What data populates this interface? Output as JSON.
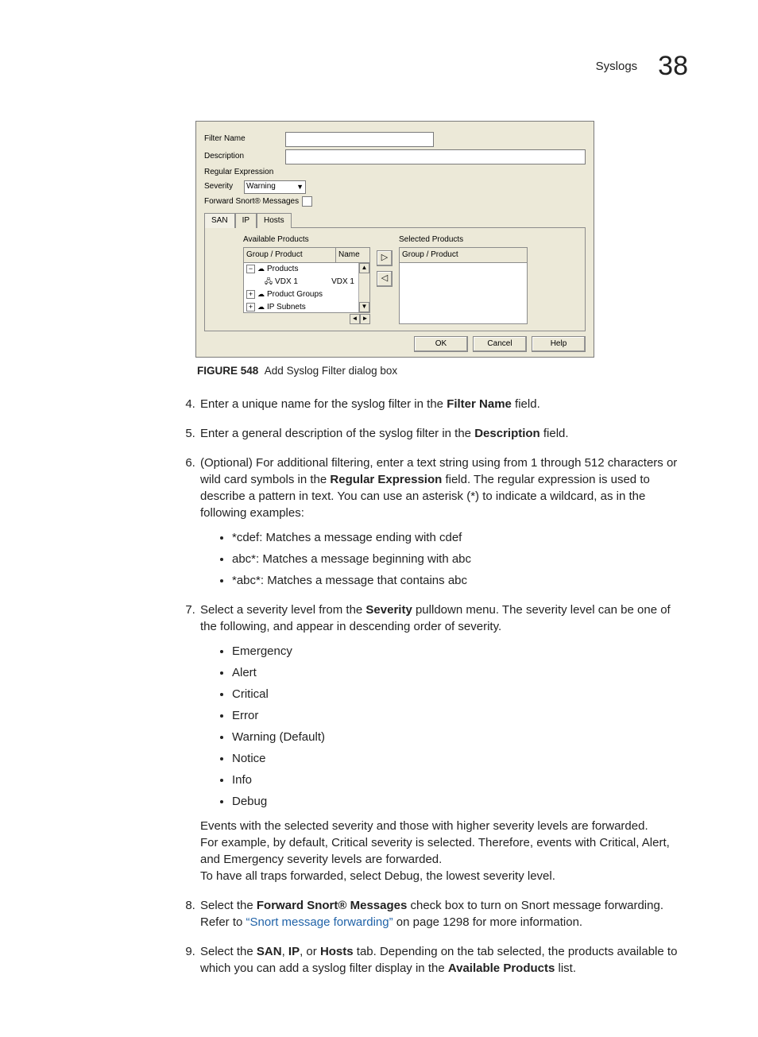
{
  "header": {
    "section": "Syslogs",
    "chapter": "38"
  },
  "dialog": {
    "labels": {
      "filterName": "Filter Name",
      "description": "Description",
      "regex": "Regular Expression",
      "severity": "Severity",
      "severityValue": "Warning",
      "forwardSnort": "Forward Snort® Messages"
    },
    "tabs": {
      "san": "SAN",
      "ip": "IP",
      "hosts": "Hosts"
    },
    "lists": {
      "availableTitle": "Available Products",
      "selectedTitle": "Selected Products",
      "colGroup": "Group / Product",
      "colName": "Name",
      "tree": {
        "products": "Products",
        "vdx1": "VDX 1",
        "vdx1name": "VDX 1",
        "productGroups": "Product Groups",
        "ipSubnets": "IP Subnets"
      }
    },
    "buttons": {
      "ok": "OK",
      "cancel": "Cancel",
      "help": "Help"
    }
  },
  "figure": {
    "label": "FIGURE 548",
    "caption": "Add Syslog Filter dialog box"
  },
  "steps": {
    "s4_a": "Enter a unique name for the syslog filter in the ",
    "s4_b": "Filter Name",
    "s4_c": " field.",
    "s5_a": "Enter a general description of the syslog filter in the ",
    "s5_b": "Description",
    "s5_c": " field.",
    "s6_a": "(Optional) For additional filtering, enter a text string using from 1 through 512 characters or wild card symbols in the ",
    "s6_b": "Regular Expression",
    "s6_c": " field. The regular expression is used to describe a pattern in text. You can use an asterisk (*) to indicate a wildcard, as in the following examples:",
    "s6_ex1": "*cdef: Matches a message ending with cdef",
    "s6_ex2": "abc*: Matches a message beginning with abc",
    "s6_ex3": "*abc*: Matches a message that contains abc",
    "s7_a": "Select a severity level from the ",
    "s7_b": "Severity",
    "s7_c": " pulldown menu. The severity level can be one of the following, and appear in descending order of severity.",
    "sev": {
      "emergency": "Emergency",
      "alert": "Alert",
      "critical": "Critical",
      "error": "Error",
      "warning": "Warning (Default)",
      "notice": "Notice",
      "info": "Info",
      "debug": "Debug"
    },
    "s7_p1": "Events with the selected severity and those with higher severity levels are forwarded.",
    "s7_p2": "For example, by default, Critical severity is selected. Therefore, events with Critical, Alert, and Emergency severity levels are forwarded.",
    "s7_p3": "To have all traps forwarded, select Debug, the lowest severity level.",
    "s8_a": "Select the ",
    "s8_b": "Forward Snort® Messages",
    "s8_c": " check box to turn on Snort message forwarding. Refer to ",
    "s8_link": "“Snort message forwarding”",
    "s8_d": " on page 1298 for more information.",
    "s9_a": "Select the ",
    "s9_san": "SAN",
    "s9_sep1": ", ",
    "s9_ip": "IP",
    "s9_sep2": ", or ",
    "s9_hosts": "Hosts",
    "s9_b": " tab. Depending on the tab selected, the products available to which you can add a syslog filter display in the ",
    "s9_avail": "Available Products",
    "s9_c": " list."
  }
}
